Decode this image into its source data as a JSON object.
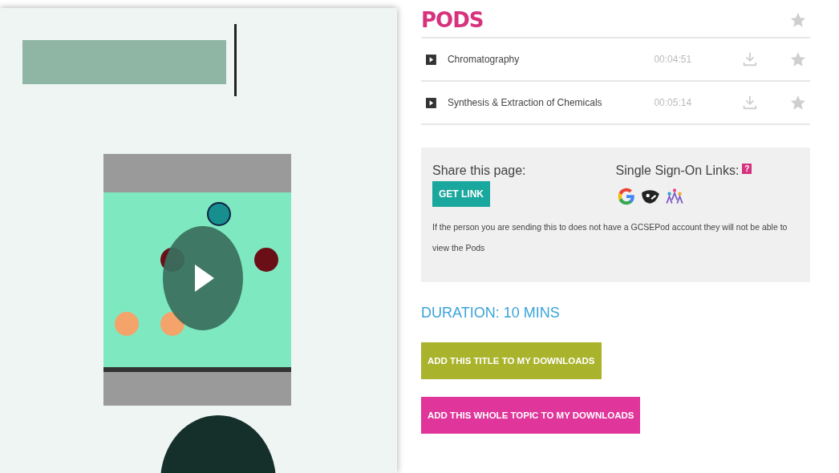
{
  "pods": {
    "title": "PODS",
    "items": [
      {
        "title": "Chromatography",
        "duration": "00:04:51"
      },
      {
        "title": "Synthesis & Extraction of Chemicals",
        "duration": "00:05:14"
      }
    ]
  },
  "share": {
    "heading": "Share this page:",
    "button": "GET LINK",
    "sso_heading": "Single Sign-On Links:",
    "help": "?",
    "note": "If the person you are sending this to does not have a GCSEPod account they will not be able to view the Pods"
  },
  "duration": "DURATION: 10 MINS",
  "buttons": [
    {
      "label": "ADD THIS TITLE TO MY DOWNLOADS",
      "kind": "title"
    },
    {
      "label": "ADD THIS WHOLE TOPIC TO MY DOWNLOADS",
      "kind": "topic"
    }
  ]
}
